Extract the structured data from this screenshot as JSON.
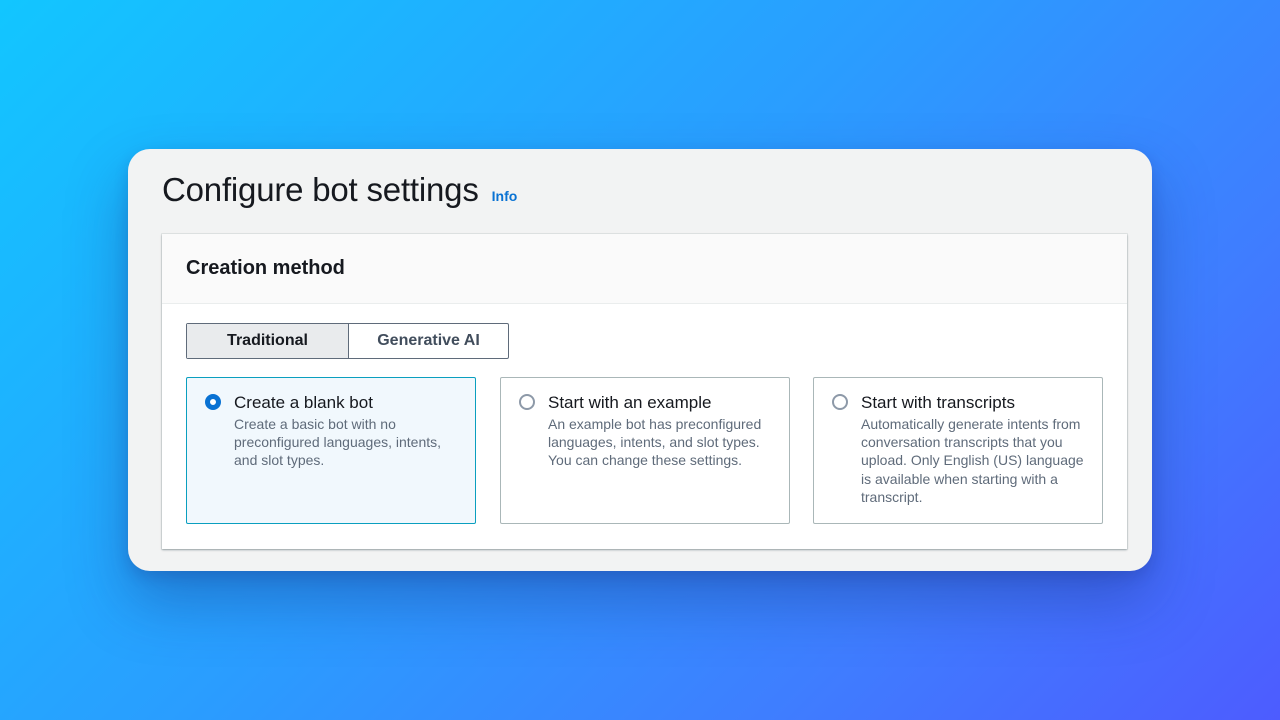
{
  "page": {
    "title": "Configure bot settings",
    "info_link": "Info"
  },
  "creation_method": {
    "title": "Creation method",
    "segments": [
      {
        "label": "Traditional",
        "selected": true
      },
      {
        "label": "Generative AI",
        "selected": false
      }
    ],
    "options": [
      {
        "title": "Create a blank bot",
        "description": "Create a basic bot with no preconfigured languages, intents, and slot types.",
        "selected": true
      },
      {
        "title": "Start with an example",
        "description": "An example bot has preconfigured languages, intents, and slot types. You can change these settings.",
        "selected": false
      },
      {
        "title": "Start with transcripts",
        "description": "Automatically generate intents from conversation transcripts that you upload. Only English (US) language is available when starting with a transcript.",
        "selected": false
      }
    ]
  },
  "colors": {
    "accent": "#0972d3",
    "selected_border": "#0a9fbf",
    "selected_background": "#f1f8fd",
    "background_gradient_start": "#12c6ff",
    "background_gradient_end": "#4d5cff"
  }
}
